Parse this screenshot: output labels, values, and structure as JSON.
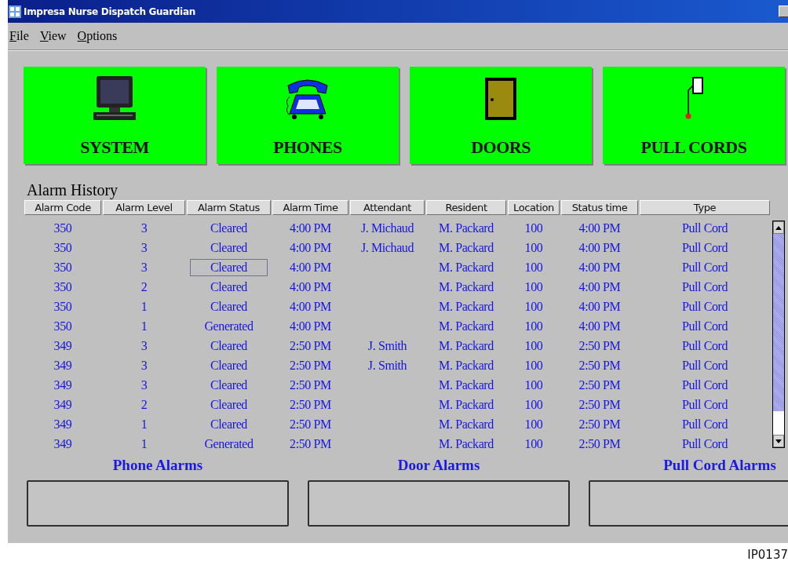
{
  "window": {
    "title": "Impresa Nurse Dispatch Guardian"
  },
  "menu": [
    {
      "label": "File"
    },
    {
      "label": "View"
    },
    {
      "label": "Options"
    }
  ],
  "category_buttons": [
    {
      "kind": "system",
      "label": "SYSTEM"
    },
    {
      "kind": "phones",
      "label": "PHONES"
    },
    {
      "kind": "doors",
      "label": "DOORS"
    },
    {
      "kind": "pull_cords",
      "label": "PULL CORDS"
    }
  ],
  "alarm_history": {
    "title": "Alarm History",
    "columns": [
      "Alarm Code",
      "Alarm Level",
      "Alarm Status",
      "Alarm Time",
      "Attendant",
      "Resident",
      "Location",
      "Status time",
      "Type"
    ],
    "rows": [
      {
        "cells": [
          "350",
          "3",
          "Cleared",
          "4:00 PM",
          "J. Michaud",
          "M. Packard",
          "100",
          "4:00 PM",
          "Pull Cord"
        ],
        "focused": false
      },
      {
        "cells": [
          "350",
          "3",
          "Cleared",
          "4:00 PM",
          "J. Michaud",
          "M. Packard",
          "100",
          "4:00 PM",
          "Pull Cord"
        ],
        "focused": false
      },
      {
        "cells": [
          "350",
          "3",
          "Cleared",
          "4:00 PM",
          "",
          "M. Packard",
          "100",
          "4:00 PM",
          "Pull Cord"
        ],
        "focused": true
      },
      {
        "cells": [
          "350",
          "2",
          "Cleared",
          "4:00 PM",
          "",
          "M. Packard",
          "100",
          "4:00 PM",
          "Pull Cord"
        ],
        "focused": false
      },
      {
        "cells": [
          "350",
          "1",
          "Cleared",
          "4:00 PM",
          "",
          "M. Packard",
          "100",
          "4:00 PM",
          "Pull Cord"
        ],
        "focused": false
      },
      {
        "cells": [
          "350",
          "1",
          "Generated",
          "4:00 PM",
          "",
          "M. Packard",
          "100",
          "4:00 PM",
          "Pull Cord"
        ],
        "focused": false
      },
      {
        "cells": [
          "349",
          "3",
          "Cleared",
          "2:50 PM",
          "J. Smith",
          "M. Packard",
          "100",
          "2:50 PM",
          "Pull Cord"
        ],
        "focused": false
      },
      {
        "cells": [
          "349",
          "3",
          "Cleared",
          "2:50 PM",
          "J. Smith",
          "M. Packard",
          "100",
          "2:50 PM",
          "Pull Cord"
        ],
        "focused": false
      },
      {
        "cells": [
          "349",
          "3",
          "Cleared",
          "2:50 PM",
          "",
          "M. Packard",
          "100",
          "2:50 PM",
          "Pull Cord"
        ],
        "focused": false
      },
      {
        "cells": [
          "349",
          "2",
          "Cleared",
          "2:50 PM",
          "",
          "M. Packard",
          "100",
          "2:50 PM",
          "Pull Cord"
        ],
        "focused": false
      },
      {
        "cells": [
          "349",
          "1",
          "Cleared",
          "2:50 PM",
          "",
          "M. Packard",
          "100",
          "2:50 PM",
          "Pull Cord"
        ],
        "focused": false
      },
      {
        "cells": [
          "349",
          "1",
          "Generated",
          "2:50 PM",
          "",
          "M. Packard",
          "100",
          "2:50 PM",
          "Pull Cord"
        ],
        "focused": false
      }
    ]
  },
  "alarm_panels": [
    {
      "title": "Phone Alarms"
    },
    {
      "title": "Door Alarms"
    },
    {
      "title": "Pull Cord Alarms"
    }
  ],
  "figure_id": "IP0137"
}
